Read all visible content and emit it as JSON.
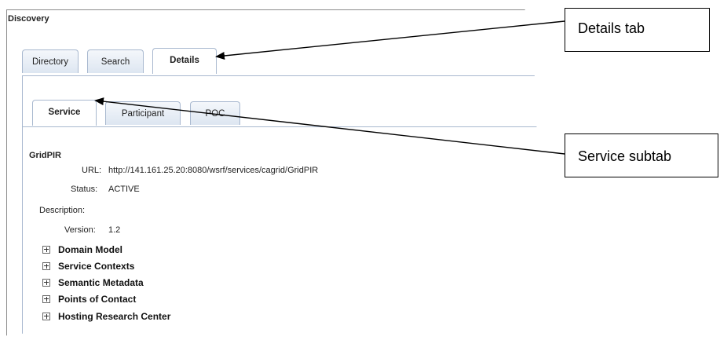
{
  "window": {
    "title": "Discovery"
  },
  "tabs": [
    {
      "label": "Directory",
      "active": false
    },
    {
      "label": "Search",
      "active": false
    },
    {
      "label": "Details",
      "active": true
    }
  ],
  "subtabs": [
    {
      "label": "Service",
      "active": true
    },
    {
      "label": "Participant",
      "active": false
    },
    {
      "label": "POC",
      "active": false
    }
  ],
  "service": {
    "name": "GridPIR",
    "url_label": "URL:",
    "url_value": "http://141.161.25.20:8080/wsrf/services/cagrid/GridPIR",
    "status_label": "Status:",
    "status_value": "ACTIVE",
    "description_label": "Description:",
    "version_label": "Version:",
    "version_value": "1.2"
  },
  "tree": [
    {
      "label": "Domain Model"
    },
    {
      "label": "Service Contexts"
    },
    {
      "label": "Semantic Metadata"
    },
    {
      "label": "Points of Contact"
    },
    {
      "label": "Hosting Research Center"
    }
  ],
  "callouts": {
    "details_tab": "Details tab",
    "service_subtab": "Service subtab"
  },
  "icons": {
    "expand": "plus-box-icon"
  }
}
